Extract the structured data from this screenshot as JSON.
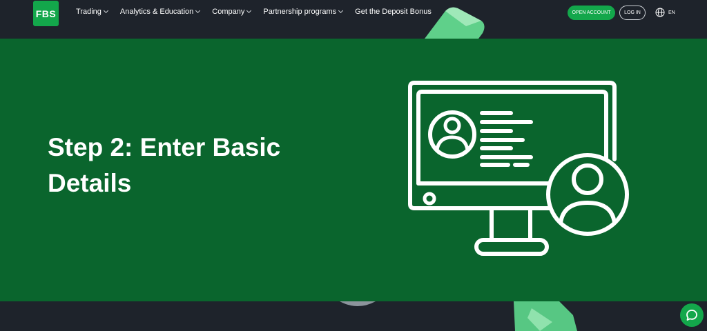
{
  "header": {
    "logo_text": "FBS",
    "nav": [
      {
        "label": "Trading",
        "has_dropdown": true
      },
      {
        "label": "Analytics & Education",
        "has_dropdown": true
      },
      {
        "label": "Company",
        "has_dropdown": true
      },
      {
        "label": "Partnership programs",
        "has_dropdown": true
      },
      {
        "label": "Get the Deposit Bonus",
        "has_dropdown": false
      }
    ],
    "open_account_label": "OPEN ACCOUNT",
    "login_label": "LOG IN",
    "language": "EN",
    "language_icon": "globe-icon"
  },
  "hero": {
    "title": "Step 2: Enter Basic Details",
    "illustration_icon": "monitor-user-profile-icon"
  },
  "chat": {
    "icon": "chat-icon"
  },
  "colors": {
    "header_bg": "#1e232b",
    "hero_bg": "#0a652d",
    "brand_green": "#13a74b",
    "text": "#ffffff"
  }
}
